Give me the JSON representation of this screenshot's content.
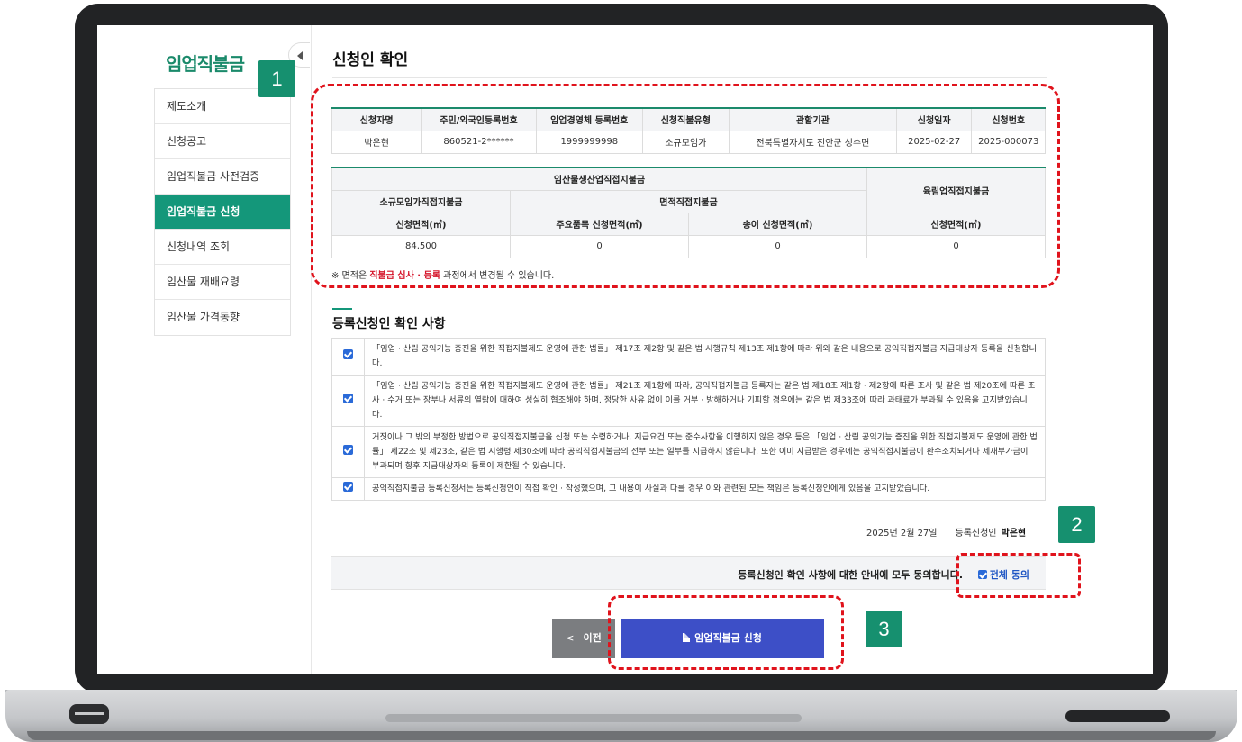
{
  "sidebar": {
    "brand": "임업직불금",
    "items": [
      {
        "label": "제도소개"
      },
      {
        "label": "신청공고"
      },
      {
        "label": "임업직불금 사전검증"
      },
      {
        "label": "임업직불금 신청",
        "active": true
      },
      {
        "label": "신청내역 조회"
      },
      {
        "label": "임산물 재배요령"
      },
      {
        "label": "임산물 가격동향"
      }
    ]
  },
  "page": {
    "title": "신청인 확인"
  },
  "applicant_table": {
    "headers": [
      "신청자명",
      "주민/외국인등록번호",
      "임업경영체 등록번호",
      "신청직불유형",
      "관할기관",
      "신청일자",
      "신청번호"
    ],
    "row": [
      "박은현",
      "860521-2******",
      "1999999998",
      "소규모임가",
      "전북특별자치도 진안군 성수면",
      "2025-02-27",
      "2025-000073"
    ]
  },
  "area_table": {
    "group_forest_product": "임산물생산업직접지불금",
    "group_reforestation": "육림업직접지불금",
    "small_scale": "소규모임가직접지불금",
    "area_based": "면적직접지불금",
    "col_small_area": "신청면적(㎡)",
    "col_main_item_area": "주요품목 신청면적(㎡)",
    "col_pine_area": "송이 신청면적(㎡)",
    "col_reforest_area": "신청면적(㎡)",
    "values": [
      "84,500",
      "0",
      "0",
      "0"
    ]
  },
  "note": {
    "prefix": "※ 면적은 ",
    "highlight": "직불금 심사 · 등록",
    "suffix": " 과정에서 변경될 수 있습니다."
  },
  "consent": {
    "title": "등록신청인 확인 사항",
    "items": [
      {
        "checked": true,
        "text": "「임업 · 산림 공익기능 증진을 위한 직접지불제도 운영에 관한 법률」 제17조 제2항 및 같은 법 시행규칙 제13조 제1항에 따라 위와 같은 내용으로 공익직접지불금 지급대상자 등록을 신청합니다."
      },
      {
        "checked": true,
        "text": "「임업 · 산림 공익기능 증진을 위한 직접지불제도 운영에 관한 법률」 제21조 제1항에 따라, 공익직접지불금 등록자는 같은 법 제18조 제1항 · 제2항에 따른 조사 및 같은 법 제20조에 따른 조사 · 수거 또는 장부나 서류의 열람에 대하여 성실히 협조해야 하며, 정당한 사유 없이 이를 거부 · 방해하거나 기피할 경우에는 같은 법 제33조에 따라 과태료가 부과될 수 있음을 고지받았습니다."
      },
      {
        "checked": true,
        "text": "거짓이나 그 밖의 부정한 방법으로 공익직접지불금을 신청 또는 수령하거나, 지급요건 또는 준수사항을 이행하지 않은 경우 등은 「임업 · 산림 공익기능 증진을 위한 직접지불제도 운영에 관한 법률」 제22조 및 제23조, 같은 법 시행령 제30조에 따라 공익직접지불금의 전부 또는 일부를 지급하지 않습니다. 또한 이미 지급받은 경우에는 공익직접지불금이 환수조치되거나 제재부가금이 부과되며 향후 지급대상자의 등록이 제한될 수 있습니다."
      },
      {
        "checked": true,
        "text": "공익직접지불금 등록신청서는 등록신청인이 직접 확인 · 작성했으며, 그 내용이 사실과 다를 경우 이와 관련된 모든 책임은 등록신청인에게 있음을 고지받았습니다."
      }
    ]
  },
  "signature": {
    "date": "2025년 2월 27일",
    "label": "등록신청인",
    "name": "박은현"
  },
  "agree": {
    "text": "등록신청인 확인 사항에 대한 안내에 모두 동의합니다.",
    "all_label": "전체 동의",
    "checked": true
  },
  "buttons": {
    "prev": "이전",
    "apply": "임업직불금 신청"
  },
  "annotations": [
    "1",
    "2",
    "3"
  ],
  "colors": {
    "brand_green": "#14977a",
    "apply_blue": "#3d4fc7",
    "annotation_red": "#e0131c",
    "highlight_red": "#d5142a"
  }
}
